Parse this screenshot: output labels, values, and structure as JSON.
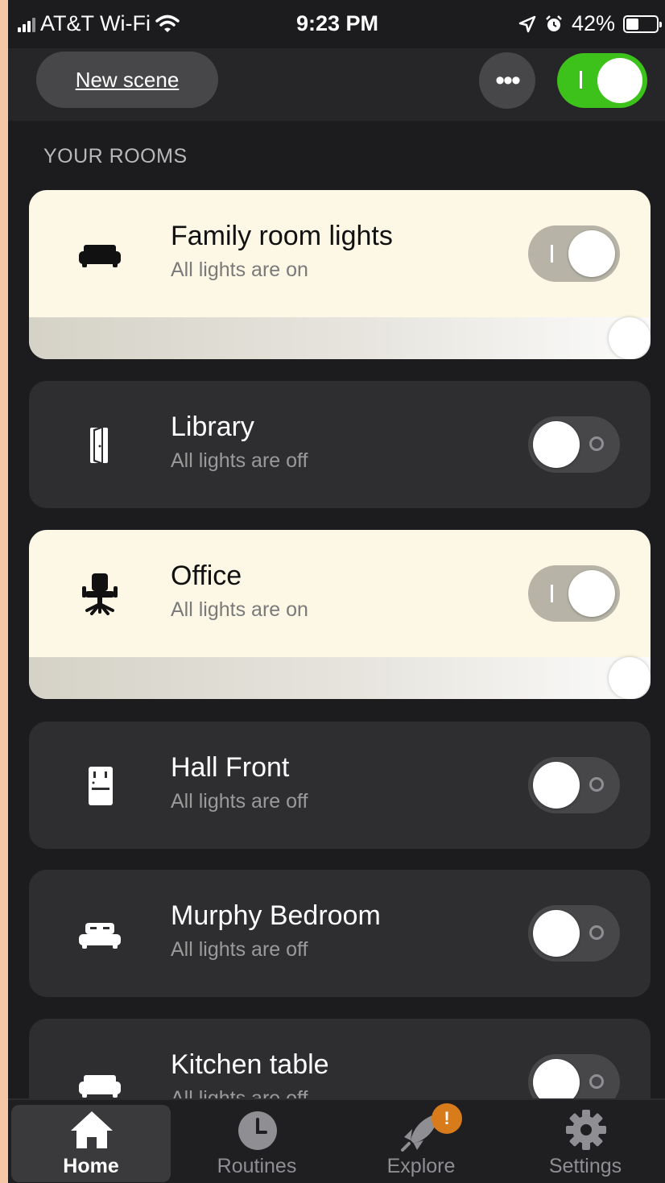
{
  "status_bar": {
    "carrier": "AT&T Wi-Fi",
    "time": "9:23 PM",
    "battery": "42%",
    "battery_level": 0.42,
    "icons": [
      "signal-icon",
      "wifi-icon",
      "location-icon",
      "alarm-icon",
      "battery-icon"
    ]
  },
  "header": {
    "new_scene_label": "New scene",
    "more_label": "•••",
    "master_toggle_on": true,
    "accent_color": "#3cc21a"
  },
  "section_title": "YOUR ROOMS",
  "rooms": [
    {
      "name": "Family room lights",
      "status": "All lights are on",
      "on": true,
      "icon": "sofa-icon",
      "brightness": 1.0
    },
    {
      "name": "Library",
      "status": "All lights are off",
      "on": false,
      "icon": "door-icon"
    },
    {
      "name": "Office",
      "status": "All lights are on",
      "on": true,
      "icon": "office-chair-icon",
      "brightness": 1.0
    },
    {
      "name": "Hall Front",
      "status": "All lights are off",
      "on": false,
      "icon": "fridge-icon"
    },
    {
      "name": "Murphy Bedroom",
      "status": "All lights are off",
      "on": false,
      "icon": "bed-icon"
    },
    {
      "name": "Kitchen table",
      "status": "All lights are off",
      "on": false,
      "icon": "sofa-icon"
    }
  ],
  "tabs": [
    {
      "label": "Home",
      "icon": "home-icon",
      "active": true
    },
    {
      "label": "Routines",
      "icon": "clock-icon",
      "active": false
    },
    {
      "label": "Explore",
      "icon": "rocket-icon",
      "active": false,
      "badge": "!"
    },
    {
      "label": "Settings",
      "icon": "gear-icon",
      "active": false
    }
  ],
  "colors": {
    "room_on_bg": "#fdf7e6",
    "room_off_bg": "#2e2e30",
    "badge": "#d87b1a"
  }
}
